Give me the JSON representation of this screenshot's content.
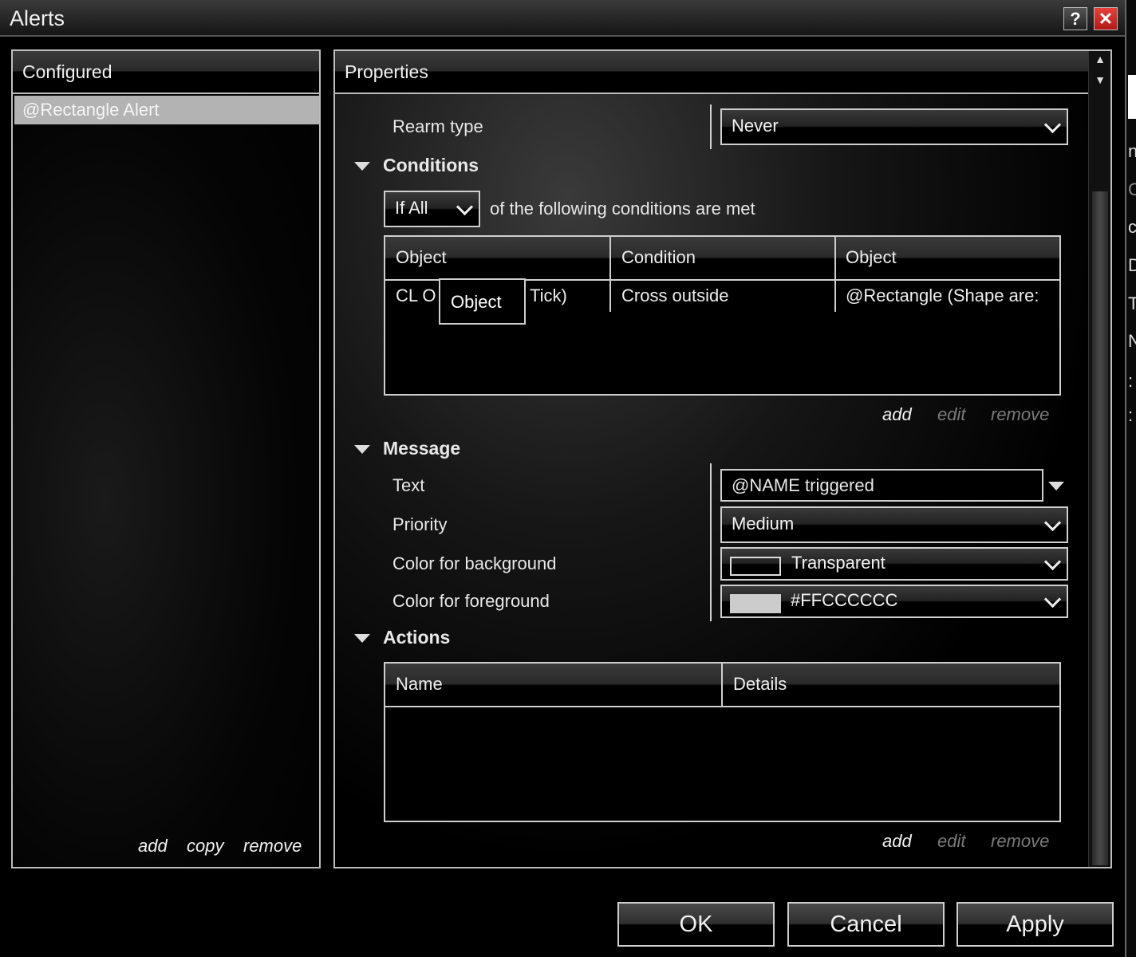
{
  "window": {
    "title": "Alerts",
    "help_label": "?",
    "close_label": "✕"
  },
  "configured": {
    "header": "Configured",
    "items": [
      "@Rectangle Alert"
    ],
    "actions": {
      "add": "add",
      "copy": "copy",
      "remove": "remove"
    }
  },
  "properties": {
    "header": "Properties",
    "rearm": {
      "label": "Rearm type",
      "value": "Never"
    },
    "conditions": {
      "title": "Conditions",
      "mode": "If All",
      "suffix": "of the following conditions are met",
      "columns": [
        "Object",
        "Condition",
        "Object"
      ],
      "rows": [
        {
          "object1": "CL O",
          "object1_tail": ") Tick)",
          "condition": "Cross outside",
          "object2": "@Rectangle (Shape are:"
        }
      ],
      "tooltip": "Object",
      "actions": {
        "add": "add",
        "edit": "edit",
        "remove": "remove"
      }
    },
    "message": {
      "title": "Message",
      "text_label": "Text",
      "text_value": "@NAME triggered",
      "priority_label": "Priority",
      "priority_value": "Medium",
      "bg_label": "Color for background",
      "bg_value": "Transparent",
      "fg_label": "Color for foreground",
      "fg_value": "#FFCCCCCC"
    },
    "actions_section": {
      "title": "Actions",
      "columns": [
        "Name",
        "Details"
      ],
      "actions": {
        "add": "add",
        "edit": "edit",
        "remove": "remove"
      }
    }
  },
  "buttons": {
    "ok": "OK",
    "cancel": "Cancel",
    "apply": "Apply"
  },
  "edge_text": [
    "ns",
    "C",
    "c",
    "D",
    "T",
    "N",
    ":",
    ":"
  ],
  "colors": {
    "active_link": "#f2f2f2",
    "disabled_link": "#7a7a7a",
    "selected_item": "#b3b3b3",
    "fg_swatch": "#cccccc"
  }
}
